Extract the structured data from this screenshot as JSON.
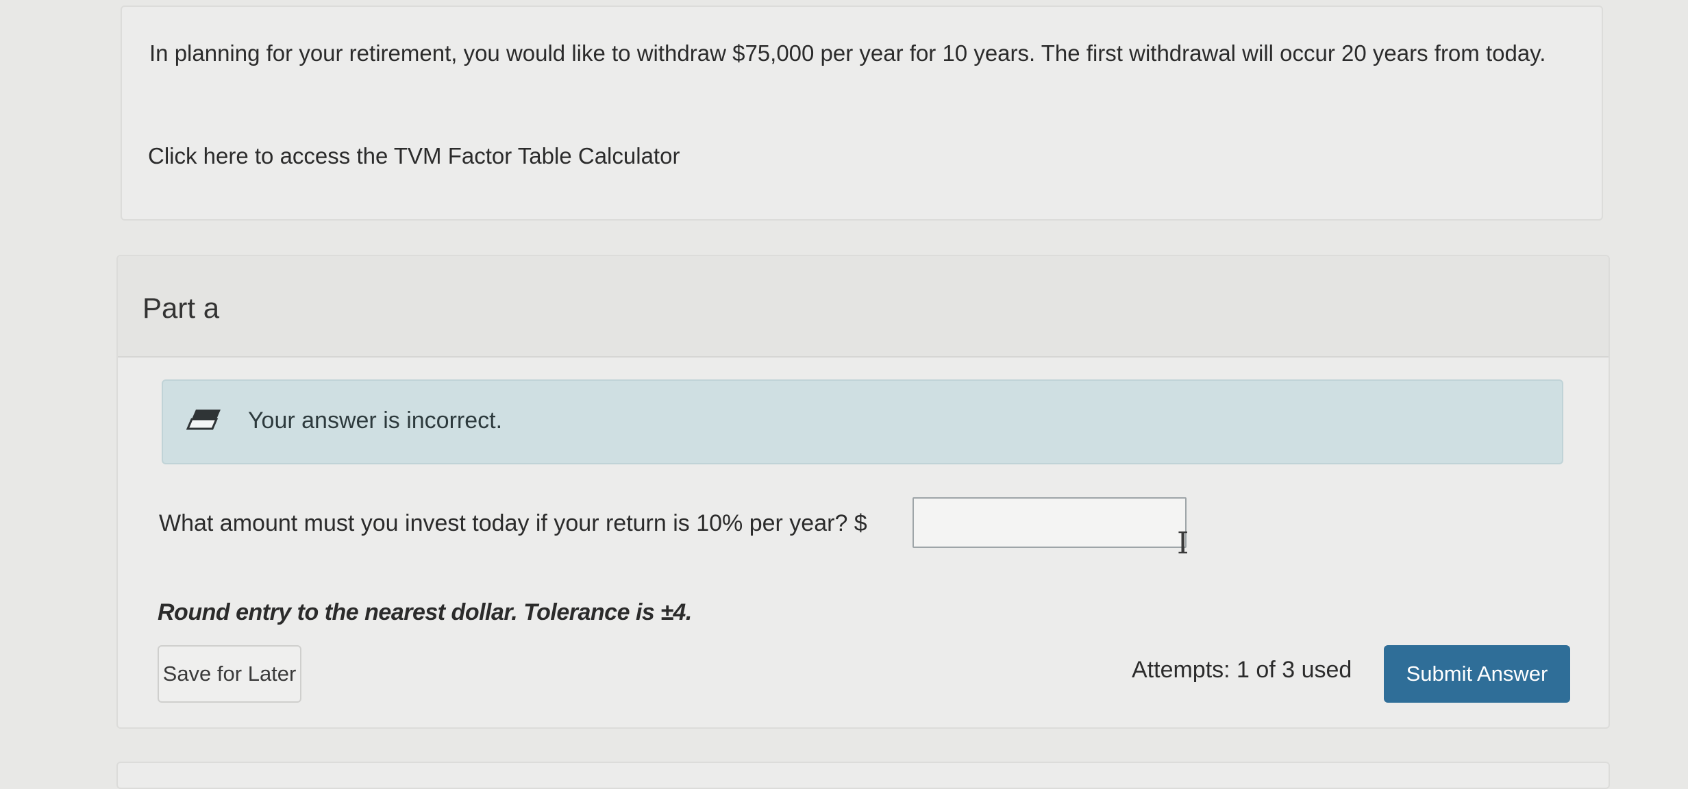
{
  "question": {
    "text": "In planning for your retirement, you would like to withdraw $75,000 per year for 10 years. The first withdrawal will occur 20 years from today.",
    "link_text": "Click here to access the TVM Factor Table Calculator"
  },
  "part": {
    "title": "Part a",
    "feedback": {
      "icon": "eraser-icon",
      "text": "Your answer is incorrect."
    },
    "prompt": "What amount must you invest today if your return is 10% per year? $",
    "answer_value": "",
    "instruction": "Round entry to the nearest dollar. Tolerance is ±4.",
    "save_label": "Save for Later",
    "attempts_text": "Attempts: 1 of 3 used",
    "submit_label": "Submit Answer"
  },
  "colors": {
    "accent": "#2f6e98",
    "alert_bg": "#cfdfe2",
    "page_bg": "#e8e8e6"
  }
}
